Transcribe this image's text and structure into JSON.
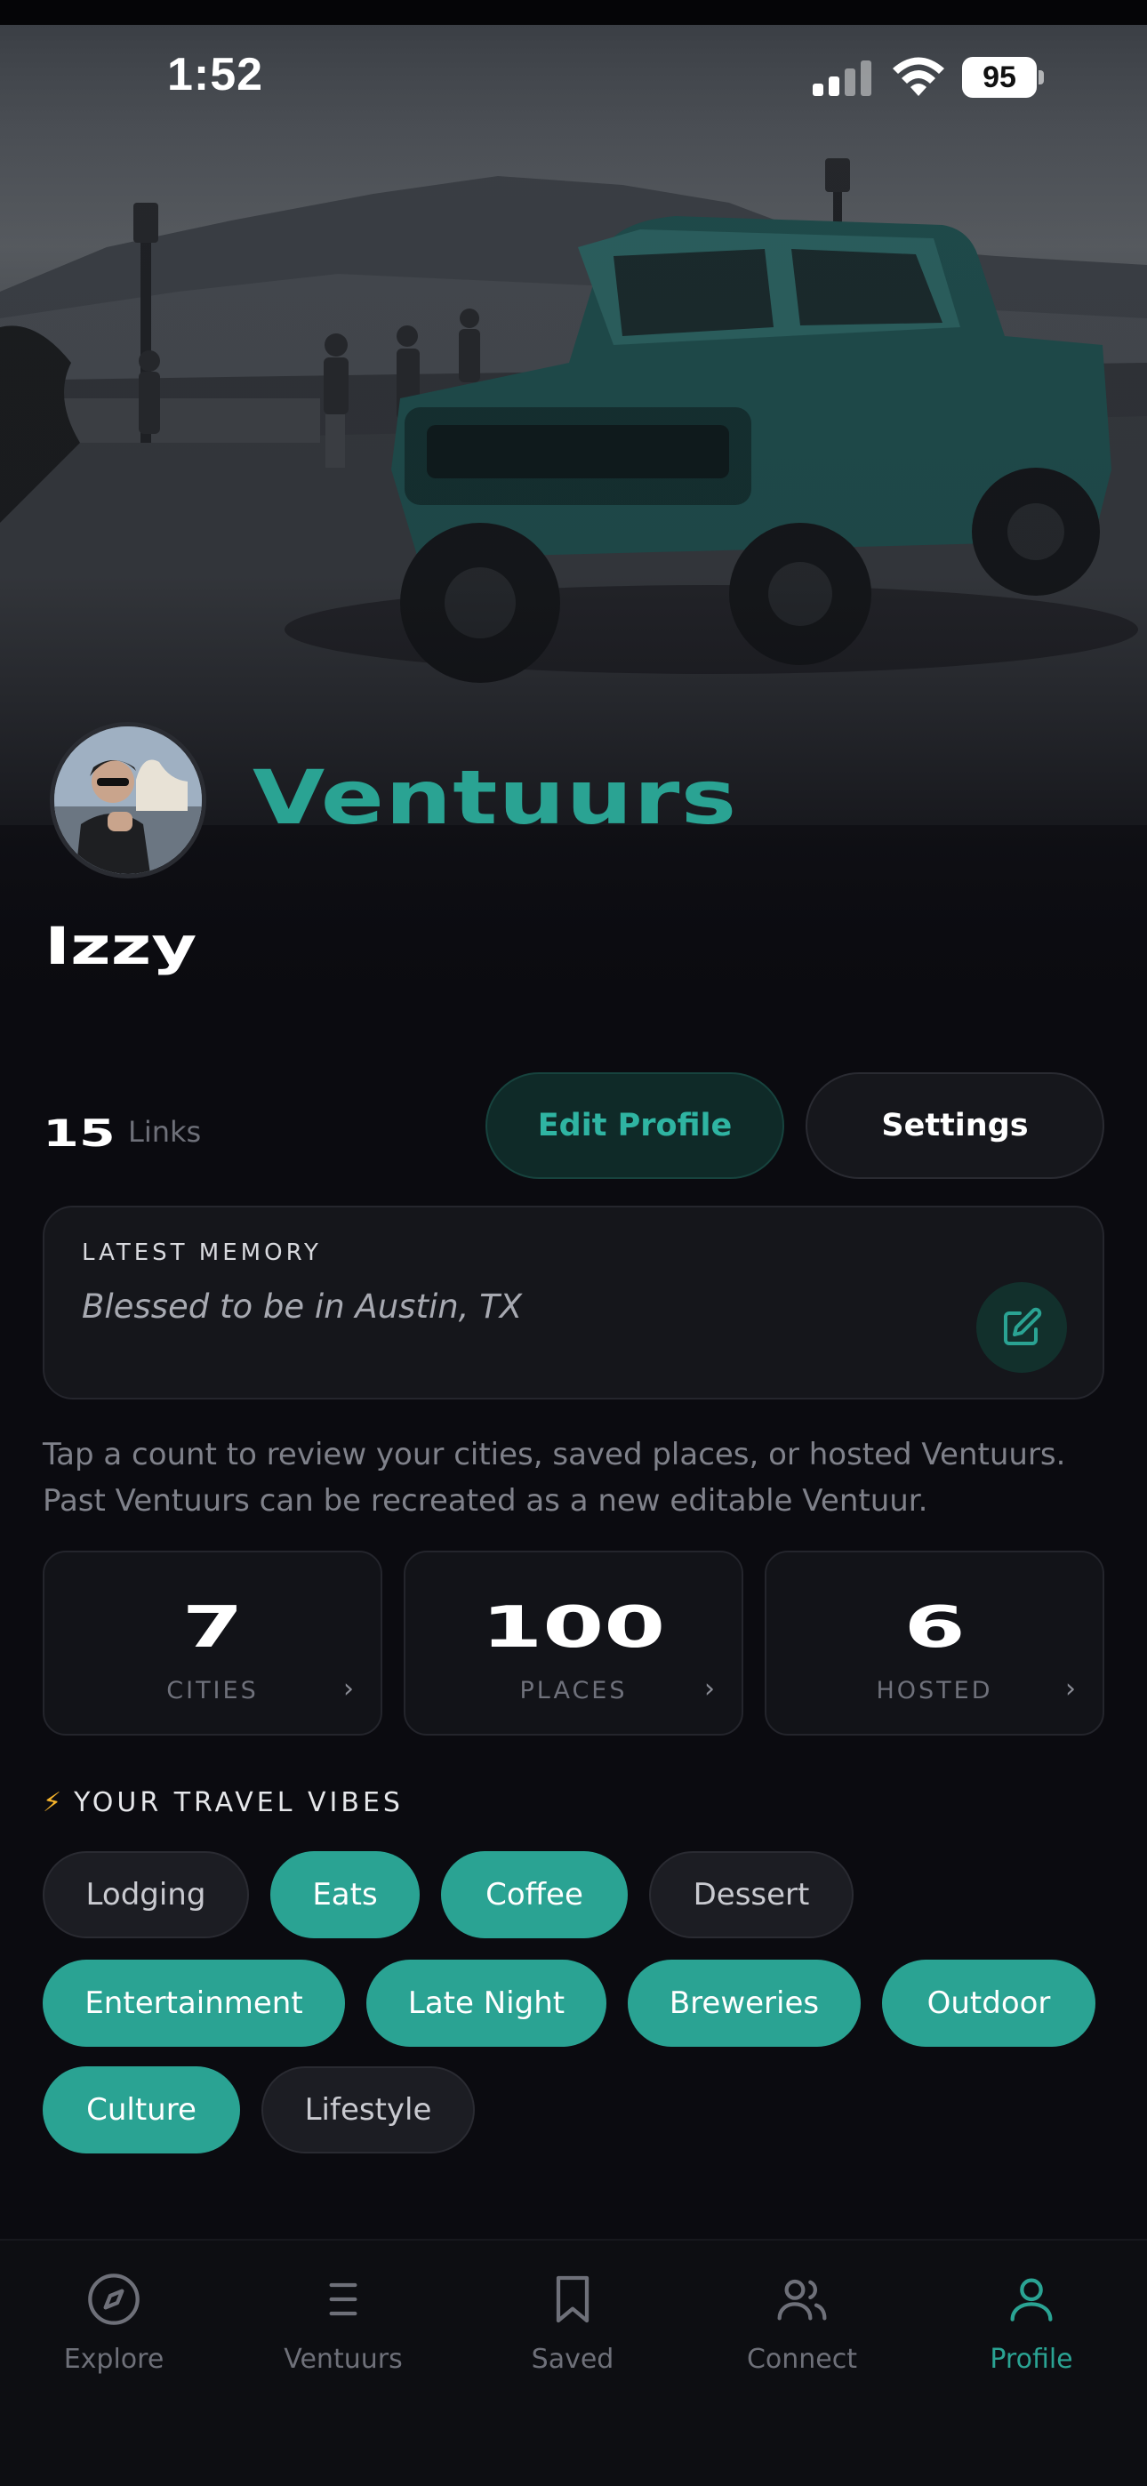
{
  "status_bar": {
    "time": "1:52",
    "battery": "95"
  },
  "brand": "Ventuurs",
  "profile": {
    "username": "Izzy",
    "links_count": "15",
    "links_label": "Links"
  },
  "actions": {
    "edit_profile": "Edit Profile",
    "settings": "Settings"
  },
  "memory": {
    "label": "LATEST MEMORY",
    "text": "Blessed to be in Austin, TX"
  },
  "hint": "Tap a count to review your cities, saved places, or hosted Ventuurs. Past Ventuurs can be recreated as a new editable Ventuur.",
  "stats": [
    {
      "value": "7",
      "label": "CITIES",
      "chevron": "›"
    },
    {
      "value": "100",
      "label": "PLACES",
      "chevron": "›"
    },
    {
      "value": "6",
      "label": "HOSTED",
      "chevron": "›"
    }
  ],
  "vibes": {
    "title": "YOUR TRAVEL VIBES",
    "bolt": "⚡",
    "chips": [
      {
        "label": "Lodging",
        "selected": false
      },
      {
        "label": "Eats",
        "selected": true
      },
      {
        "label": "Coffee",
        "selected": true
      },
      {
        "label": "Dessert",
        "selected": false
      },
      {
        "label": "Entertainment",
        "selected": true
      },
      {
        "label": "Late Night",
        "selected": true
      },
      {
        "label": "Breweries",
        "selected": true
      },
      {
        "label": "Outdoor",
        "selected": true
      },
      {
        "label": "Culture",
        "selected": true
      },
      {
        "label": "Lifestyle",
        "selected": false
      }
    ]
  },
  "tabs": [
    {
      "label": "Explore",
      "icon": "compass-icon",
      "active": false
    },
    {
      "label": "Ventuurs",
      "icon": "list-icon",
      "active": false
    },
    {
      "label": "Saved",
      "icon": "bookmark-icon",
      "active": false
    },
    {
      "label": "Connect",
      "icon": "people-icon",
      "active": false
    },
    {
      "label": "Profile",
      "icon": "person-icon",
      "active": true
    }
  ],
  "colors": {
    "accent": "#2aa393",
    "background": "#0b0b10",
    "chip_off": "#1c1d23"
  }
}
